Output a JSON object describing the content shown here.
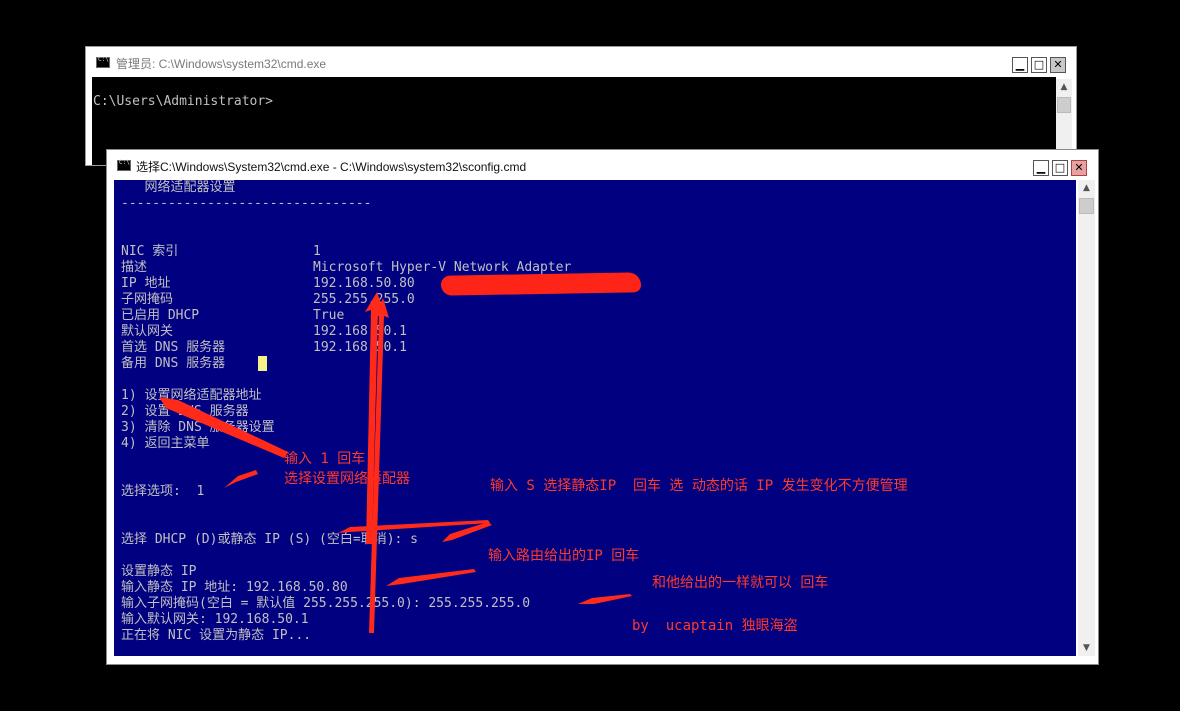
{
  "back_window": {
    "title": "管理员: C:\\Windows\\system32\\cmd.exe",
    "prompt": "C:\\Users\\Administrator>",
    "minimize": "▁",
    "maximize": "□",
    "close": "✕"
  },
  "front_window": {
    "title": "选择C:\\Windows\\System32\\cmd.exe - C:\\Windows\\system32\\sconfig.cmd",
    "minimize": "▁",
    "maximize": "□",
    "close": "✕",
    "scroll_up": "▲",
    "scroll_down": "▼",
    "header": "   网络适配器设置",
    "separator": "--------------------------------",
    "fields": [
      {
        "label": "NIC 索引",
        "value": "1"
      },
      {
        "label": "描述",
        "value": "Microsoft Hyper-V Network Adapter"
      },
      {
        "label": "IP 地址",
        "value": "192.168.50.80"
      },
      {
        "label": "子网掩码",
        "value": "255.255.255.0"
      },
      {
        "label": "已启用 DHCP",
        "value": "True"
      },
      {
        "label": "默认网关",
        "value": "192.168.50.1"
      },
      {
        "label": "首选 DNS 服务器",
        "value": "192.168.50.1"
      },
      {
        "label": "备用 DNS 服务器",
        "value": ""
      }
    ],
    "menu": [
      "1) 设置网络适配器地址",
      "2) 设置 DNS 服务器",
      "3) 清除 DNS 服务器设置",
      "4) 返回主菜单"
    ],
    "select_option_prompt": "选择选项:  1",
    "dhcp_prompt": "选择 DHCP (D)或静态 IP (S) (空白=取消): s",
    "set_static": "设置静态 IP",
    "ip_input": "输入静态 IP 地址: 192.168.50.80",
    "mask_input": "输入子网掩码(空白 = 默认值 255.255.255.0): 255.255.255.0",
    "gateway_input": "输入默认网关: 192.168.50.1",
    "applying": "正在将 NIC 设置为静态 IP..."
  },
  "annotations": {
    "enter_1": "输入 1 回车",
    "select_adapter": "选择设置网络适配器",
    "enter_s": "输入 S 选择静态IP  回车 选 动态的话 IP 发生变化不方便管理",
    "enter_router_ip": "输入路由给出的IP 回车",
    "same_as_given": "和他给出的一样就可以 回车",
    "author": "by  ucaptain 独眼海盗"
  },
  "colors": {
    "console_bg": "#000080",
    "console_text": "#c0c0c0",
    "annotation": "#ff3a2a",
    "redaction": "#ff2418"
  }
}
